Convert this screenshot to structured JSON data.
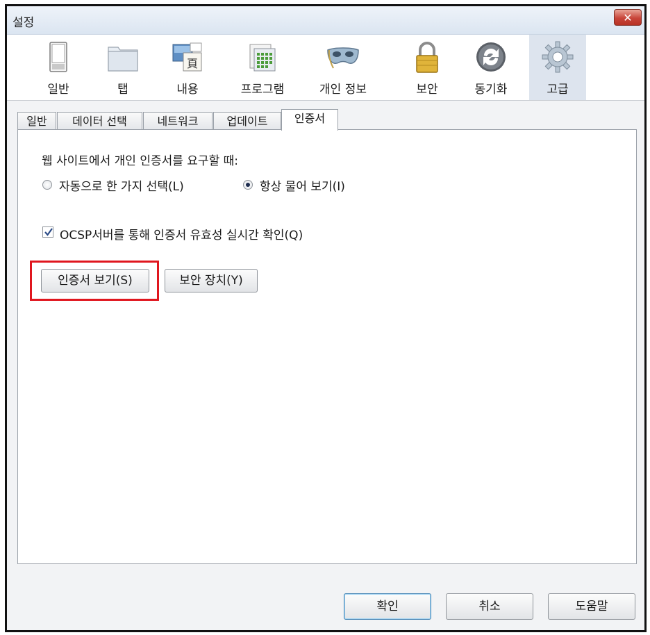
{
  "window": {
    "title": "설정",
    "close_label": "✕"
  },
  "toolbar": {
    "items": [
      {
        "label": "일반",
        "icon": "switch-icon"
      },
      {
        "label": "탭",
        "icon": "tabs-icon"
      },
      {
        "label": "내용",
        "icon": "content-icon"
      },
      {
        "label": "프로그램",
        "icon": "programs-icon"
      },
      {
        "label": "개인 정보",
        "icon": "mask-icon"
      },
      {
        "label": "보안",
        "icon": "padlock-icon"
      },
      {
        "label": "동기화",
        "icon": "sync-icon"
      },
      {
        "label": "고급",
        "icon": "gear-icon"
      }
    ],
    "active_index": 7
  },
  "tabs": {
    "items": [
      "일반",
      "데이터 선택",
      "네트워크",
      "업데이트",
      "인증서"
    ],
    "selected_index": 4
  },
  "certificates": {
    "request_prompt": "웹 사이트에서 개인 인증서를 요구할 때:",
    "option_auto": "자동으로 한 가지 선택(L)",
    "option_ask": "항상 물어 보기(I)",
    "selected_option": "option_ask",
    "ocsp_label": "OCSP서버를 통해 인증서 유효성 실시간 확인(Q)",
    "ocsp_checked": true,
    "view_certificates_button": "인증서 보기(S)",
    "security_devices_button": "보안 장치(Y)"
  },
  "footer": {
    "ok_button": "확인",
    "cancel_button": "취소",
    "help_button": "도움말"
  },
  "colors": {
    "highlight": "#e0161e",
    "active_tab_bg": "#dde4ee"
  }
}
